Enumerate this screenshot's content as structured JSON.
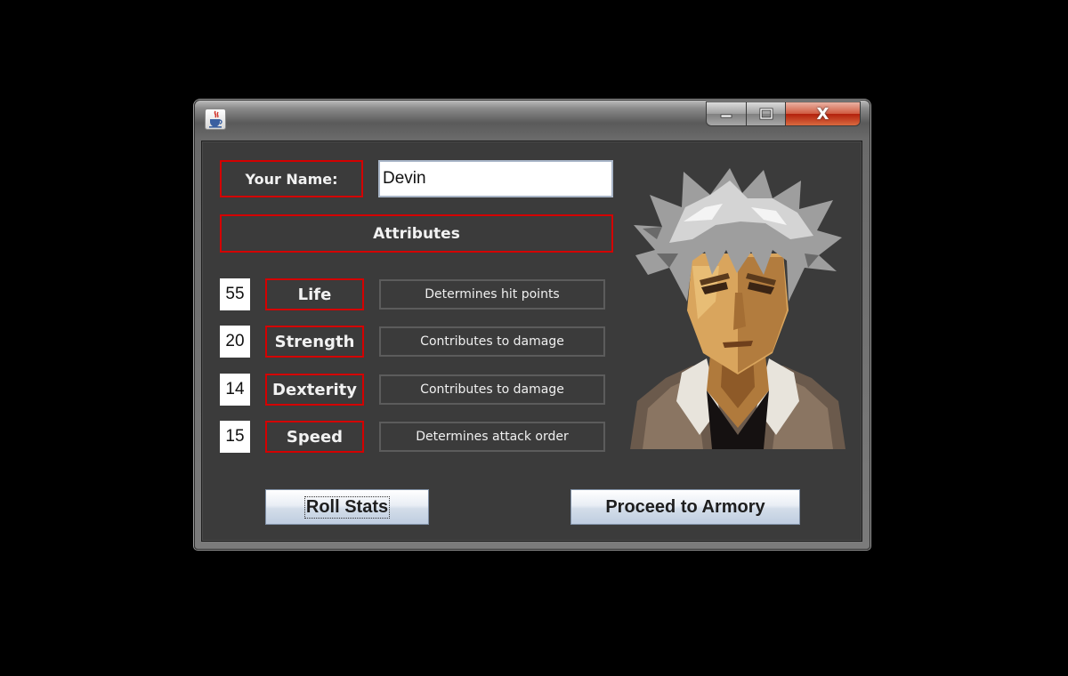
{
  "window": {
    "close_glyph": "X"
  },
  "form": {
    "name_label": "Your Name:",
    "name_value": "Devin",
    "attributes_header": "Attributes"
  },
  "stats": [
    {
      "value": "55",
      "name": "Life",
      "description": "Determines hit points"
    },
    {
      "value": "20",
      "name": "Strength",
      "description": "Contributes to damage"
    },
    {
      "value": "14",
      "name": "Dexterity",
      "description": "Contributes to damage"
    },
    {
      "value": "15",
      "name": "Speed",
      "description": "Determines attack order"
    }
  ],
  "buttons": {
    "roll_label": "Roll Stats",
    "proceed_label": "Proceed to Armory"
  },
  "colors": {
    "accent_border": "#d40000",
    "panel_bg": "#3b3b3b",
    "close_button": "#c0311a"
  },
  "icons": {
    "app": "java-coffee-cup-icon",
    "minimize": "minimize-icon",
    "maximize": "maximize-icon",
    "close": "close-icon"
  }
}
